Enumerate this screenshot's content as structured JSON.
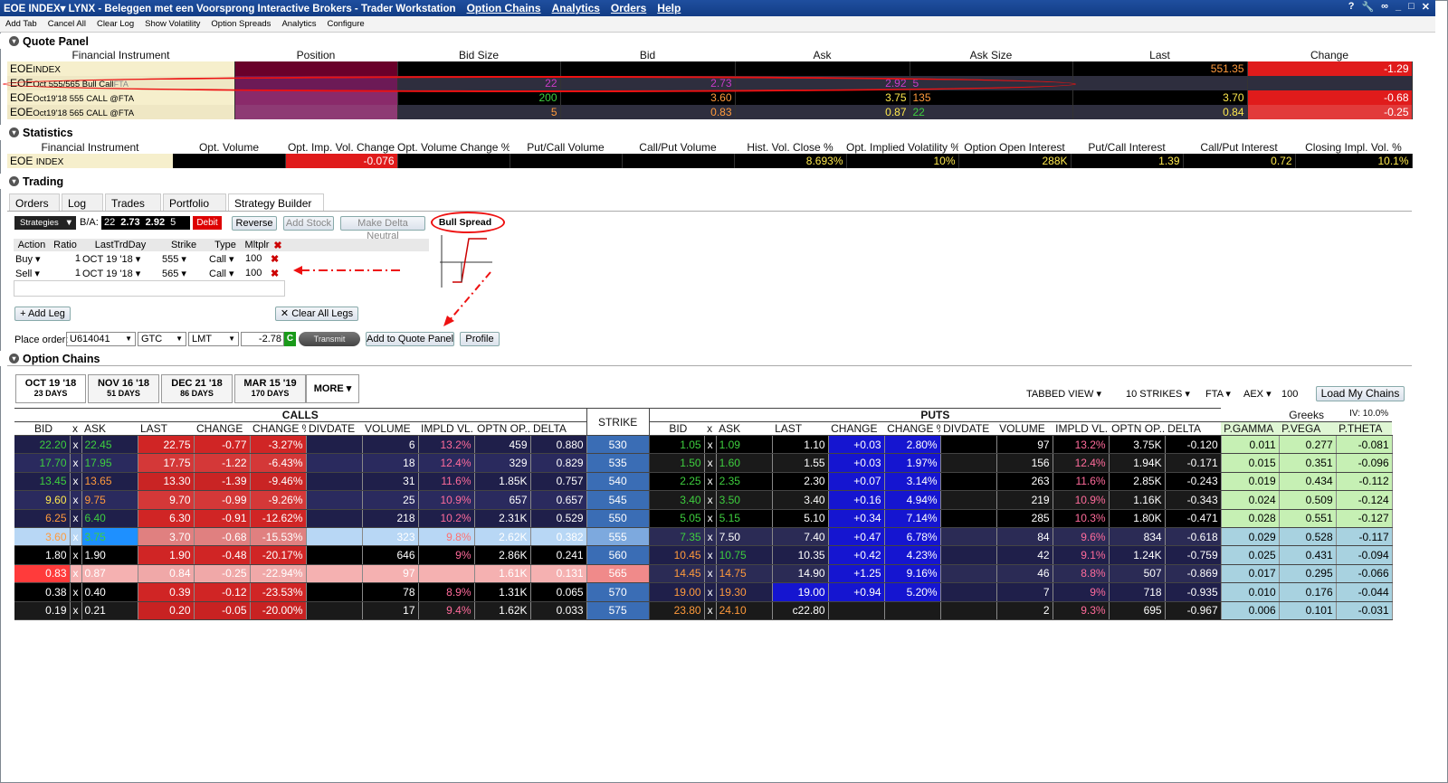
{
  "window": {
    "title": "EOE INDEX▾ LYNX - Beleggen met een Voorsprong Interactive Brokers - Trader Workstation",
    "menus": [
      "Option Chains",
      "Analytics",
      "Orders",
      "Help"
    ]
  },
  "toolbar": {
    "items": [
      "Add Tab",
      "Cancel All",
      "Clear Log",
      "Show Volatility",
      "Option Spreads",
      "Analytics",
      "Configure"
    ]
  },
  "quote_panel": {
    "title": "Quote Panel",
    "columns": [
      "Financial Instrument",
      "Position",
      "Bid Size",
      "Bid",
      "Ask",
      "Ask Size",
      "Last",
      "Change"
    ],
    "rows": [
      {
        "sym": "EOE",
        "desc": "INDEX",
        "position": "",
        "bid_size": "",
        "bid": "",
        "ask": "",
        "ask_size": "",
        "last": "551.35",
        "change": "-1.29"
      },
      {
        "sym": "EOE",
        "desc": "Oct 555/565 Bull Call",
        "desc2": "FTA",
        "position": "",
        "bid_size": "22",
        "bid": "2.73",
        "ask": "2.92",
        "ask_size": "5",
        "last": "",
        "change": ""
      },
      {
        "sym": "EOE",
        "desc": "Oct19'18 555 CALL @FTA",
        "position": "",
        "bid_size": "200",
        "bid": "3.60",
        "ask": "3.75",
        "ask_size": "135",
        "last": "3.70",
        "change": "-0.68"
      },
      {
        "sym": "EOE",
        "desc": "Oct19'18 565 CALL @FTA",
        "position": "",
        "bid_size": "5",
        "bid": "0.83",
        "ask": "0.87",
        "ask_size": "22",
        "last": "0.84",
        "change": "-0.25"
      }
    ]
  },
  "statistics": {
    "title": "Statistics",
    "columns": [
      "Financial Instrument",
      "Opt. Volume",
      "Opt. Imp. Vol. Change",
      "Opt. Volume Change %",
      "Put/Call Volume",
      "Call/Put Volume",
      "Hist. Vol. Close %",
      "Opt. Implied Volatility %",
      "Option Open Interest",
      "Put/Call Interest",
      "Call/Put Interest",
      "Closing Impl. Vol. %"
    ],
    "row": {
      "sym": "EOE",
      "desc": "INDEX",
      "values": [
        "",
        "-0.076",
        "",
        "",
        "",
        "8.693%",
        "10%",
        "288K",
        "1.39",
        "0.72",
        "10.1%"
      ]
    }
  },
  "trading": {
    "title": "Trading",
    "tabs": [
      "Orders",
      "Log",
      "Trades",
      "Portfolio",
      "Strategy Builder"
    ],
    "strategies_label": "Strategies",
    "ba_label": "B/A:",
    "ba_bidsize": "22",
    "ba_bid": "2.73",
    "ba_ask": "2.92",
    "ba_asksize": "5",
    "debit": "Debit",
    "buttons": {
      "reverse": "Reverse",
      "add_stock": "Add Stock",
      "delta_neutral": "Make Delta Neutral",
      "bull_spread": "Bull Spread",
      "add_leg": "Add Leg",
      "clear_legs": "Clear All Legs",
      "add_quote": "Add to Quote Panel",
      "profile": "Profile",
      "transmit": "Transmit"
    },
    "leg_columns": [
      "Action",
      "Ratio",
      "LastTrdDay",
      "Strike",
      "Type",
      "Mltplr"
    ],
    "legs": [
      {
        "action": "Buy",
        "ratio": "1",
        "day": "OCT 19 '18",
        "strike": "555",
        "type": "Call",
        "mult": "100"
      },
      {
        "action": "Sell",
        "ratio": "1",
        "day": "OCT 19 '18",
        "strike": "565",
        "type": "Call",
        "mult": "100"
      }
    ],
    "place_order": {
      "label": "Place order:",
      "account": "U614041",
      "tif": "GTC",
      "type": "LMT",
      "price": "-2.78",
      "c": "C"
    }
  },
  "option_chains": {
    "title": "Option Chains",
    "expiries": [
      {
        "date": "OCT 19 '18",
        "days": "23 DAYS"
      },
      {
        "date": "NOV 16 '18",
        "days": "51 DAYS"
      },
      {
        "date": "DEC 21 '18",
        "days": "86 DAYS"
      },
      {
        "date": "MAR 15 '19",
        "days": "170 DAYS"
      }
    ],
    "more": "MORE",
    "view": "TABBED VIEW",
    "strikes": "10 STRIKES",
    "exch": "FTA",
    "underlying": "AEX",
    "mult": "100",
    "load": "Load My Chains",
    "calls_label": "CALLS",
    "puts_label": "PUTS",
    "strike_label": "STRIKE",
    "greeks_label": "Greeks",
    "iv_label": "IV: 10.0%",
    "call_cols": [
      "BID",
      "x",
      "ASK",
      "LAST",
      "CHANGE",
      "CHANGE %",
      "DIVDATE",
      "VOLUME",
      "IMPLD VL...",
      "OPTN OP...",
      "DELTA"
    ],
    "put_cols": [
      "BID",
      "x",
      "ASK",
      "LAST",
      "CHANGE",
      "CHANGE %",
      "DIVDATE",
      "VOLUME",
      "IMPLD VL...",
      "OPTN OP...",
      "DELTA"
    ],
    "greek_cols": [
      "P.GAMMA",
      "P.VEGA",
      "P.THETA"
    ],
    "rows": [
      {
        "c": [
          "22.20",
          "x",
          "22.45",
          "22.75",
          "-0.77",
          "-3.27%",
          "",
          "6",
          "13.2%",
          "459",
          "0.880"
        ],
        "k": "530",
        "p": [
          "1.05",
          "x",
          "1.09",
          "1.10",
          "+0.03",
          "2.80%",
          "",
          "97",
          "13.2%",
          "3.75K",
          "-0.120"
        ],
        "g": [
          "0.011",
          "0.277",
          "-0.081"
        ]
      },
      {
        "c": [
          "17.70",
          "x",
          "17.95",
          "17.75",
          "-1.22",
          "-6.43%",
          "",
          "18",
          "12.4%",
          "329",
          "0.829"
        ],
        "k": "535",
        "p": [
          "1.50",
          "x",
          "1.60",
          "1.55",
          "+0.03",
          "1.97%",
          "",
          "156",
          "12.4%",
          "1.94K",
          "-0.171"
        ],
        "g": [
          "0.015",
          "0.351",
          "-0.096"
        ]
      },
      {
        "c": [
          "13.45",
          "x",
          "13.65",
          "13.30",
          "-1.39",
          "-9.46%",
          "",
          "31",
          "11.6%",
          "1.85K",
          "0.757"
        ],
        "k": "540",
        "p": [
          "2.25",
          "x",
          "2.35",
          "2.30",
          "+0.07",
          "3.14%",
          "",
          "263",
          "11.6%",
          "2.85K",
          "-0.243"
        ],
        "g": [
          "0.019",
          "0.434",
          "-0.112"
        ]
      },
      {
        "c": [
          "9.60",
          "x",
          "9.75",
          "9.70",
          "-0.99",
          "-9.26%",
          "",
          "25",
          "10.9%",
          "657",
          "0.657"
        ],
        "k": "545",
        "p": [
          "3.40",
          "x",
          "3.50",
          "3.40",
          "+0.16",
          "4.94%",
          "",
          "219",
          "10.9%",
          "1.16K",
          "-0.343"
        ],
        "g": [
          "0.024",
          "0.509",
          "-0.124"
        ]
      },
      {
        "c": [
          "6.25",
          "x",
          "6.40",
          "6.30",
          "-0.91",
          "-12.62%",
          "",
          "218",
          "10.2%",
          "2.31K",
          "0.529"
        ],
        "k": "550",
        "p": [
          "5.05",
          "x",
          "5.15",
          "5.10",
          "+0.34",
          "7.14%",
          "",
          "285",
          "10.3%",
          "1.80K",
          "-0.471"
        ],
        "g": [
          "0.028",
          "0.551",
          "-0.127"
        ]
      },
      {
        "c": [
          "3.60",
          "x",
          "3.75",
          "3.70",
          "-0.68",
          "-15.53%",
          "",
          "323",
          "9.8%",
          "2.62K",
          "0.382"
        ],
        "k": "555",
        "p": [
          "7.35",
          "x",
          "7.50",
          "7.40",
          "+0.47",
          "6.78%",
          "",
          "84",
          "9.6%",
          "834",
          "-0.618"
        ],
        "g": [
          "0.029",
          "0.528",
          "-0.117"
        ]
      },
      {
        "c": [
          "1.80",
          "x",
          "1.90",
          "1.90",
          "-0.48",
          "-20.17%",
          "",
          "646",
          "9%",
          "2.86K",
          "0.241"
        ],
        "k": "560",
        "p": [
          "10.45",
          "x",
          "10.75",
          "10.35",
          "+0.42",
          "4.23%",
          "",
          "42",
          "9.1%",
          "1.24K",
          "-0.759"
        ],
        "g": [
          "0.025",
          "0.431",
          "-0.094"
        ]
      },
      {
        "c": [
          "0.83",
          "x",
          "0.87",
          "0.84",
          "-0.25",
          "-22.94%",
          "",
          "97",
          "",
          "1.61K",
          "0.131"
        ],
        "k": "565",
        "p": [
          "14.45",
          "x",
          "14.75",
          "14.90",
          "+1.25",
          "9.16%",
          "",
          "46",
          "8.8%",
          "507",
          "-0.869"
        ],
        "g": [
          "0.017",
          "0.295",
          "-0.066"
        ]
      },
      {
        "c": [
          "0.38",
          "x",
          "0.40",
          "0.39",
          "-0.12",
          "-23.53%",
          "",
          "78",
          "8.9%",
          "1.31K",
          "0.065"
        ],
        "k": "570",
        "p": [
          "19.00",
          "x",
          "19.30",
          "19.00",
          "+0.94",
          "5.20%",
          "",
          "7",
          "9%",
          "718",
          "-0.935"
        ],
        "g": [
          "0.010",
          "0.176",
          "-0.044"
        ]
      },
      {
        "c": [
          "0.19",
          "x",
          "0.21",
          "0.20",
          "-0.05",
          "-20.00%",
          "",
          "17",
          "9.4%",
          "1.62K",
          "0.033"
        ],
        "k": "575",
        "p": [
          "23.80",
          "x",
          "24.10",
          "c22.80",
          "",
          "",
          "",
          "2",
          "9.3%",
          "695",
          "-0.967"
        ],
        "g": [
          "0.006",
          "0.101",
          "-0.031"
        ]
      }
    ]
  }
}
